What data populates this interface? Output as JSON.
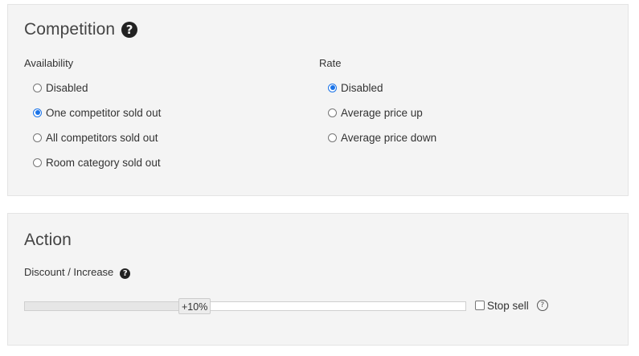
{
  "competition": {
    "title": "Competition",
    "help_icon": "help-circle-solid-icon",
    "availability": {
      "label": "Availability",
      "options": [
        {
          "label": "Disabled",
          "checked": false
        },
        {
          "label": "One competitor sold out",
          "checked": true
        },
        {
          "label": "All competitors sold out",
          "checked": false
        },
        {
          "label": "Room category sold out",
          "checked": false
        }
      ]
    },
    "rate": {
      "label": "Rate",
      "options": [
        {
          "label": "Disabled",
          "checked": true
        },
        {
          "label": "Average price up",
          "checked": false
        },
        {
          "label": "Average price down",
          "checked": false
        }
      ]
    }
  },
  "action": {
    "title": "Action",
    "discount": {
      "label": "Discount / Increase",
      "help_icon": "help-circle-solid-icon",
      "value_label": "+10%",
      "slider_fraction": 0.35
    },
    "stop_sell": {
      "label": "Stop sell",
      "checked": false,
      "help_icon": "help-circle-outline-icon"
    }
  },
  "colors": {
    "accent": "#1a73e8",
    "panel_bg": "#f4f4f4"
  }
}
